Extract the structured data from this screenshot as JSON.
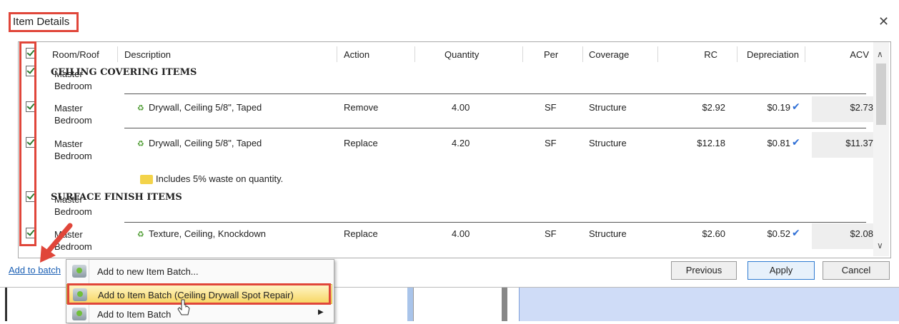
{
  "dialog": {
    "title": "Item Details",
    "close_glyph": "✕"
  },
  "columns": {
    "room": "Room/Roof",
    "description": "Description",
    "action": "Action",
    "quantity": "Quantity",
    "per": "Per",
    "coverage": "Coverage",
    "rc": "RC",
    "depreciation": "Depreciation",
    "acv": "ACV"
  },
  "rows": [
    {
      "room_line1": "Master",
      "room_line2": "Bedroom",
      "group_label": "CEILING COVERING ITEMS"
    },
    {
      "room_line1": "Master",
      "room_line2": "Bedroom",
      "description": "Drywall, Ceiling 5/8\", Taped",
      "action": "Remove",
      "quantity": "4.00",
      "per": "SF",
      "coverage": "Structure",
      "rc": "$2.92",
      "depreciation": "$0.19",
      "acv": "$2.73"
    },
    {
      "room_line1": "Master",
      "room_line2": "Bedroom",
      "description": "Drywall, Ceiling 5/8\", Taped",
      "action": "Replace",
      "quantity": "4.20",
      "per": "SF",
      "coverage": "Structure",
      "rc": "$12.18",
      "depreciation": "$0.81",
      "acv": "$11.37"
    },
    {
      "note": "Includes 5% waste on quantity."
    },
    {
      "room_line1": "Master",
      "room_line2": "Bedroom",
      "group_label": "SURFACE FINISH ITEMS"
    },
    {
      "room_line1": "Master",
      "room_line2": "Bedroom",
      "description": "Texture, Ceiling, Knockdown",
      "action": "Replace",
      "quantity": "4.00",
      "per": "SF",
      "coverage": "Structure",
      "rc": "$2.60",
      "depreciation": "$0.52",
      "acv": "$2.08"
    }
  ],
  "footer": {
    "add_to_batch_link": "Add to batch",
    "previous": "Previous",
    "apply": "Apply",
    "cancel": "Cancel"
  },
  "context_menu": {
    "items": [
      {
        "label": "Add to new Item Batch..."
      },
      {
        "label": "Add to Item Batch (Ceiling Drywall Spot Repair)",
        "highlighted": true
      },
      {
        "label": "Add to Item Batch",
        "has_submenu": true
      }
    ]
  },
  "colors": {
    "annotation_red": "#e0463a",
    "accent_blue": "#2f7bd1",
    "menu_highlight": "#f7d663"
  }
}
